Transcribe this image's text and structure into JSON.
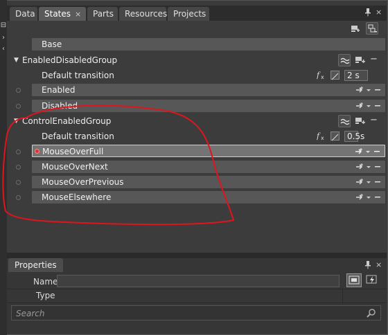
{
  "tabs": [
    {
      "label": "Data"
    },
    {
      "label": "States",
      "close": "×"
    },
    {
      "label": "Parts"
    },
    {
      "label": "Resources"
    },
    {
      "label": "Projects"
    }
  ],
  "base_state": {
    "label": "Base"
  },
  "groups": [
    {
      "name": "EnabledDisabledGroup",
      "default_transition": {
        "label": "Default transition",
        "duration": "2 s"
      },
      "states": [
        {
          "label": "Enabled"
        },
        {
          "label": "Disabled"
        }
      ]
    },
    {
      "name": "ControlEnabledGroup",
      "default_transition": {
        "label": "Default transition",
        "duration": "0.5",
        "unit": "s"
      },
      "states": [
        {
          "label": "MouseOverFull",
          "selected": true,
          "recording": true
        },
        {
          "label": "MouseOverNext"
        },
        {
          "label": "MouseOverPrevious"
        },
        {
          "label": "MouseElsewhere"
        }
      ]
    }
  ],
  "properties": {
    "tab_label": "Properties",
    "name_label": "Name",
    "name_value": "",
    "type_label": "Type",
    "type_value": ""
  },
  "search": {
    "placeholder": "Search"
  },
  "colors": {
    "panel_bg": "#3c3c3c",
    "row_bg": "#575757",
    "selected_row_bg": "#747474",
    "annotation_red": "#e0141e",
    "record_dot": "#dd3333"
  }
}
